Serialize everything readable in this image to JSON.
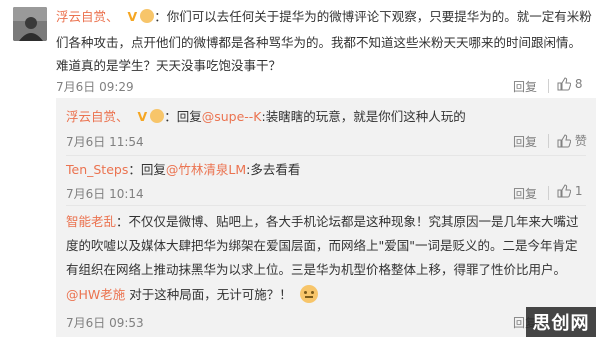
{
  "top_comment": {
    "username": "浮云自赏、",
    "separator": "：",
    "line1": "你们可以去任何关于提华为的微博评论下观察，只要提华为的。就一定有米粉",
    "line2": "们各种攻击，点开他们的微博都是各种骂华为的。我都不知道这些米粉天天哪来的时间跟闲情。",
    "line3": "难道真的是学生？天天没事吃饱没事干？",
    "time": "7月6日 09:29",
    "reply_label": "回复",
    "like_count": "8"
  },
  "replies": [
    {
      "username": "浮云自赏、",
      "reply_to_prefix": "：回复",
      "reply_to": "@supe--K",
      "text": ":装瞎瞎的玩意，就是你们这种人玩的",
      "time": "7月6日 11:54",
      "reply_label": "回复",
      "like_label": "赞"
    },
    {
      "username": "Ten_Steps",
      "reply_to_prefix": "：回复",
      "reply_to": "@竹林清泉LM",
      "text": ":多去看看",
      "time": "7月6日 10:14",
      "reply_label": "回复",
      "like_count": "1"
    },
    {
      "username": "智能老乱",
      "separator": "：",
      "line1": "不仅仅是微博、贴吧上，各大手机论坛都是这种现象！究其原因一是几年来大嘴过",
      "line2": "度的吹嘘以及媒体大肆把华为绑架在爱国层面，而网络上\"爱国\"一词是贬义的。二是今年肯定",
      "line3": "有组织在网络上推动抹黑华为以求上位。三是华为机型价格整体上移，得罪了性价比用户。",
      "mention": "@HW老施",
      "mention_text": "对于这种局面，无计可施？！",
      "time": "7月6日 09:53",
      "reply_label": "回复"
    }
  ],
  "watermark": "思创网"
}
